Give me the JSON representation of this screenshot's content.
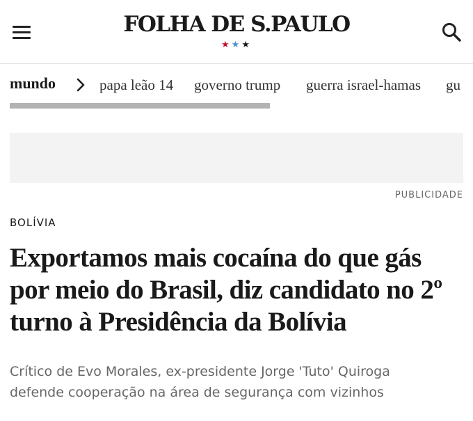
{
  "header": {
    "logo": "FOLHA DE S.PAULO",
    "stars": [
      "★",
      "★",
      "★"
    ],
    "menu_icon": "hamburger-menu-icon",
    "search_icon": "search-icon"
  },
  "nav": {
    "section": "mundo",
    "chevron_icon": "chevron-right-icon",
    "links": [
      "papa leão 14",
      "governo trump",
      "guerra israel-hamas",
      "gu"
    ]
  },
  "ad": {
    "label": "PUBLICIDADE"
  },
  "article": {
    "kicker": "BOLÍVIA",
    "headline_lines": [
      "Exportamos mais cocaína do que gás",
      "por meio do Brasil, diz candidato no 2º",
      "turno à Presidência da Bolívia"
    ],
    "subhead_lines": [
      "Crítico de Evo Morales, ex-presidente Jorge 'Tuto' Quiroga",
      "defende cooperação na área de segurança com vizinhos"
    ]
  },
  "colors": {
    "star_red": "#c8102e",
    "star_blue": "#4a90d9",
    "star_black": "#1a1a1a",
    "text": "#1a1a1a",
    "muted": "#666666"
  }
}
